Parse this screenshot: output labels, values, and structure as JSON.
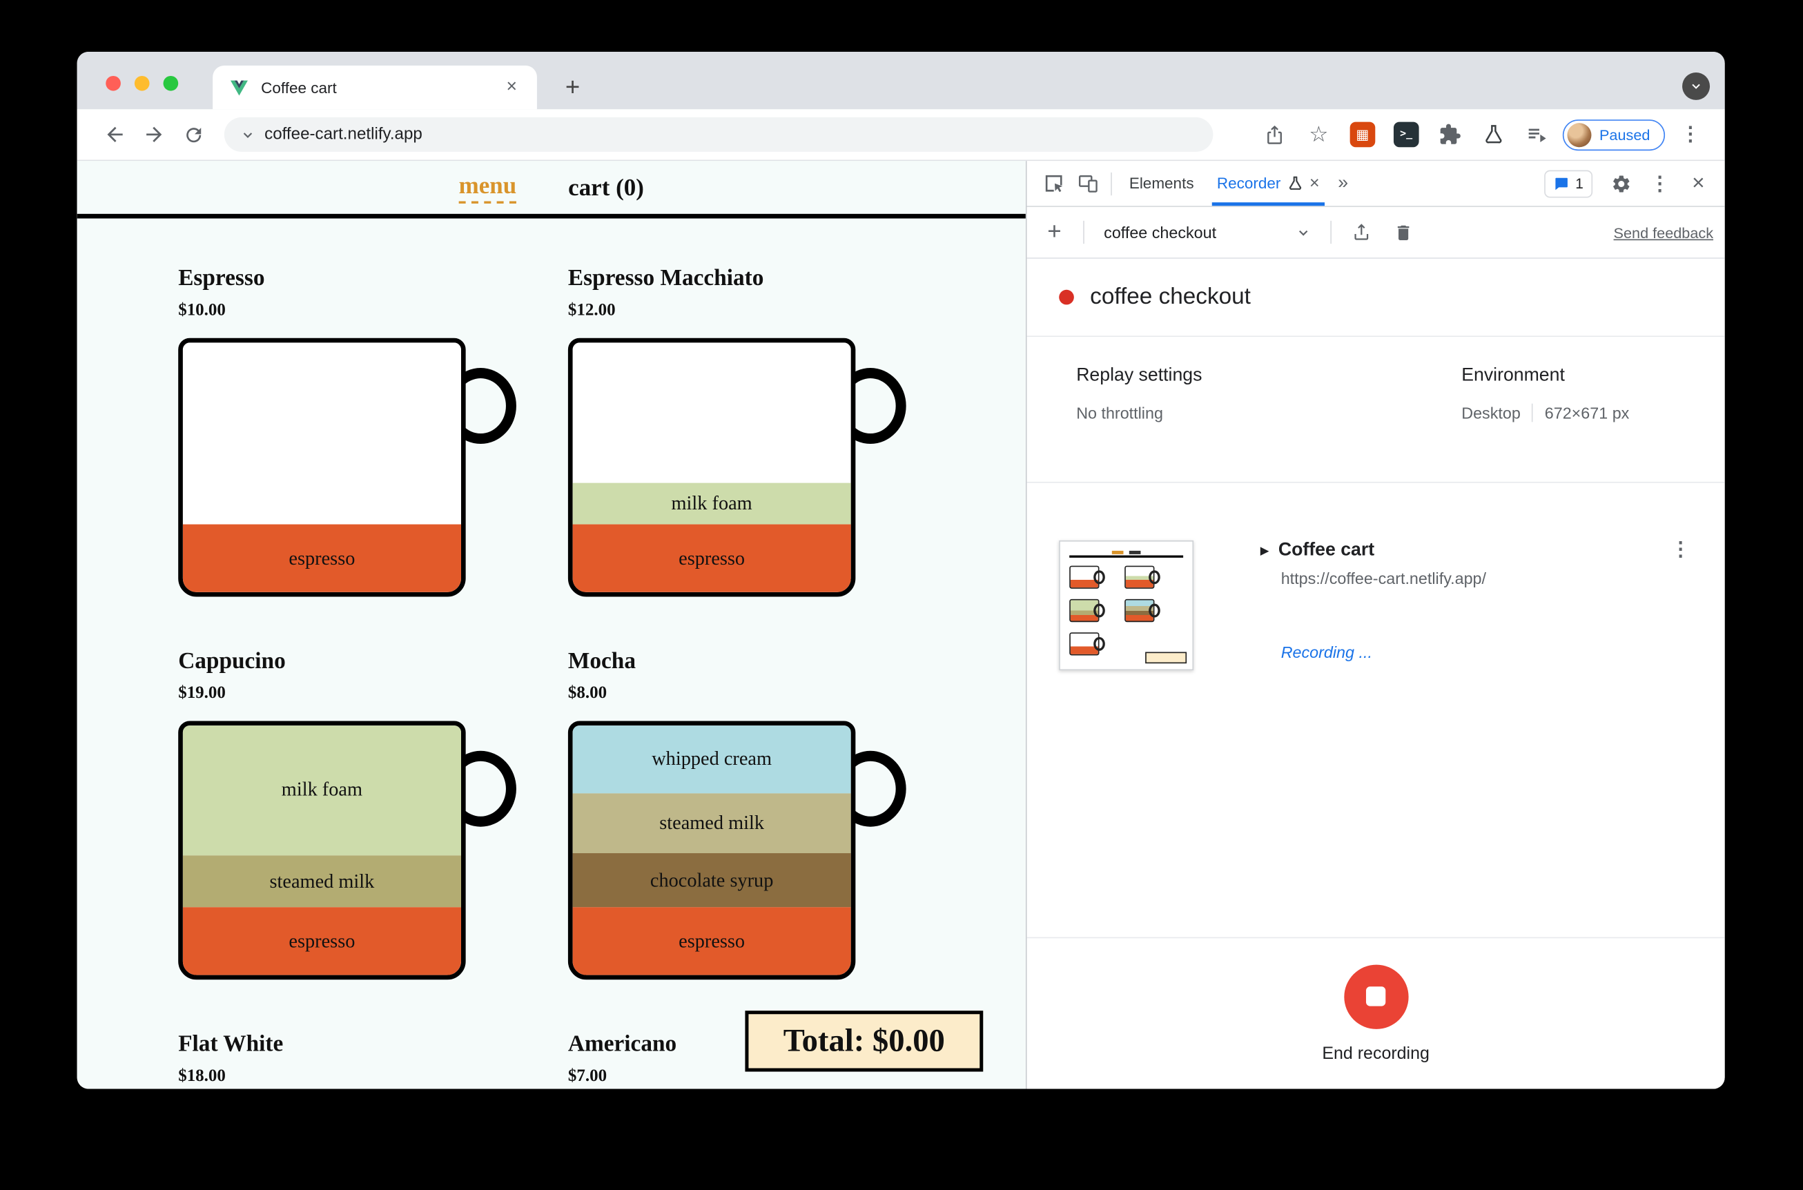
{
  "browser": {
    "tab_title": "Coffee cart",
    "url": "coffee-cart.netlify.app",
    "paused_label": "Paused"
  },
  "icons": {
    "plus": "+",
    "close": "×",
    "star": "☆",
    "kebab": "⋮",
    "more_tabs": "»",
    "disclosure": "▶",
    "terminal_glyph": ">_",
    "grid_glyph": "▦"
  },
  "app": {
    "nav": {
      "menu": "menu",
      "cart": "cart (0)"
    },
    "total_label": "Total: $0.00",
    "items": [
      {
        "name": "Espresso",
        "price": "$10.00",
        "layers": [
          {
            "label": "espresso",
            "color": "#e25a2a",
            "height": 27
          }
        ]
      },
      {
        "name": "Espresso Macchiato",
        "price": "$12.00",
        "layers": [
          {
            "label": "milk foam",
            "color": "#cddcab",
            "height": 17
          },
          {
            "label": "espresso",
            "color": "#e25a2a",
            "height": 27
          }
        ]
      },
      {
        "name": "Cappucino",
        "price": "$19.00",
        "layers": [
          {
            "label": "milk foam",
            "color": "#cddcab",
            "height": 52
          },
          {
            "label": "steamed milk",
            "color": "#b3ac72",
            "height": 21
          },
          {
            "label": "espresso",
            "color": "#e25a2a",
            "height": 27
          }
        ]
      },
      {
        "name": "Mocha",
        "price": "$8.00",
        "layers": [
          {
            "label": "whipped cream",
            "color": "#aedbe2",
            "height": 27
          },
          {
            "label": "steamed milk",
            "color": "#bfb88a",
            "height": 24
          },
          {
            "label": "chocolate syrup",
            "color": "#8b6d40",
            "height": 22
          },
          {
            "label": "espresso",
            "color": "#e25a2a",
            "height": 27
          }
        ]
      },
      {
        "name": "Flat White",
        "price": "$18.00",
        "layers": []
      },
      {
        "name": "Americano",
        "price": "$7.00",
        "layers": []
      }
    ]
  },
  "devtools": {
    "tabs": {
      "elements": "Elements",
      "recorder": "Recorder"
    },
    "issues_badge": "1",
    "toolbar": {
      "recording_name": "coffee checkout",
      "send_feedback": "Send feedback"
    },
    "header": {
      "title": "coffee checkout"
    },
    "settings": {
      "replay_label": "Replay settings",
      "throttling": "No throttling",
      "environment_label": "Environment",
      "device": "Desktop",
      "viewport": "672×671 px"
    },
    "step": {
      "title": "Coffee cart",
      "url": "https://coffee-cart.netlify.app/",
      "status": "Recording ..."
    },
    "footer": {
      "end_recording": "End recording"
    }
  },
  "colors": {
    "accent_blue": "#1a73e8",
    "record_red": "#d93025",
    "stop_red": "#ea4335",
    "menu_orange": "#d9942b",
    "total_bg": "#fcecca"
  }
}
